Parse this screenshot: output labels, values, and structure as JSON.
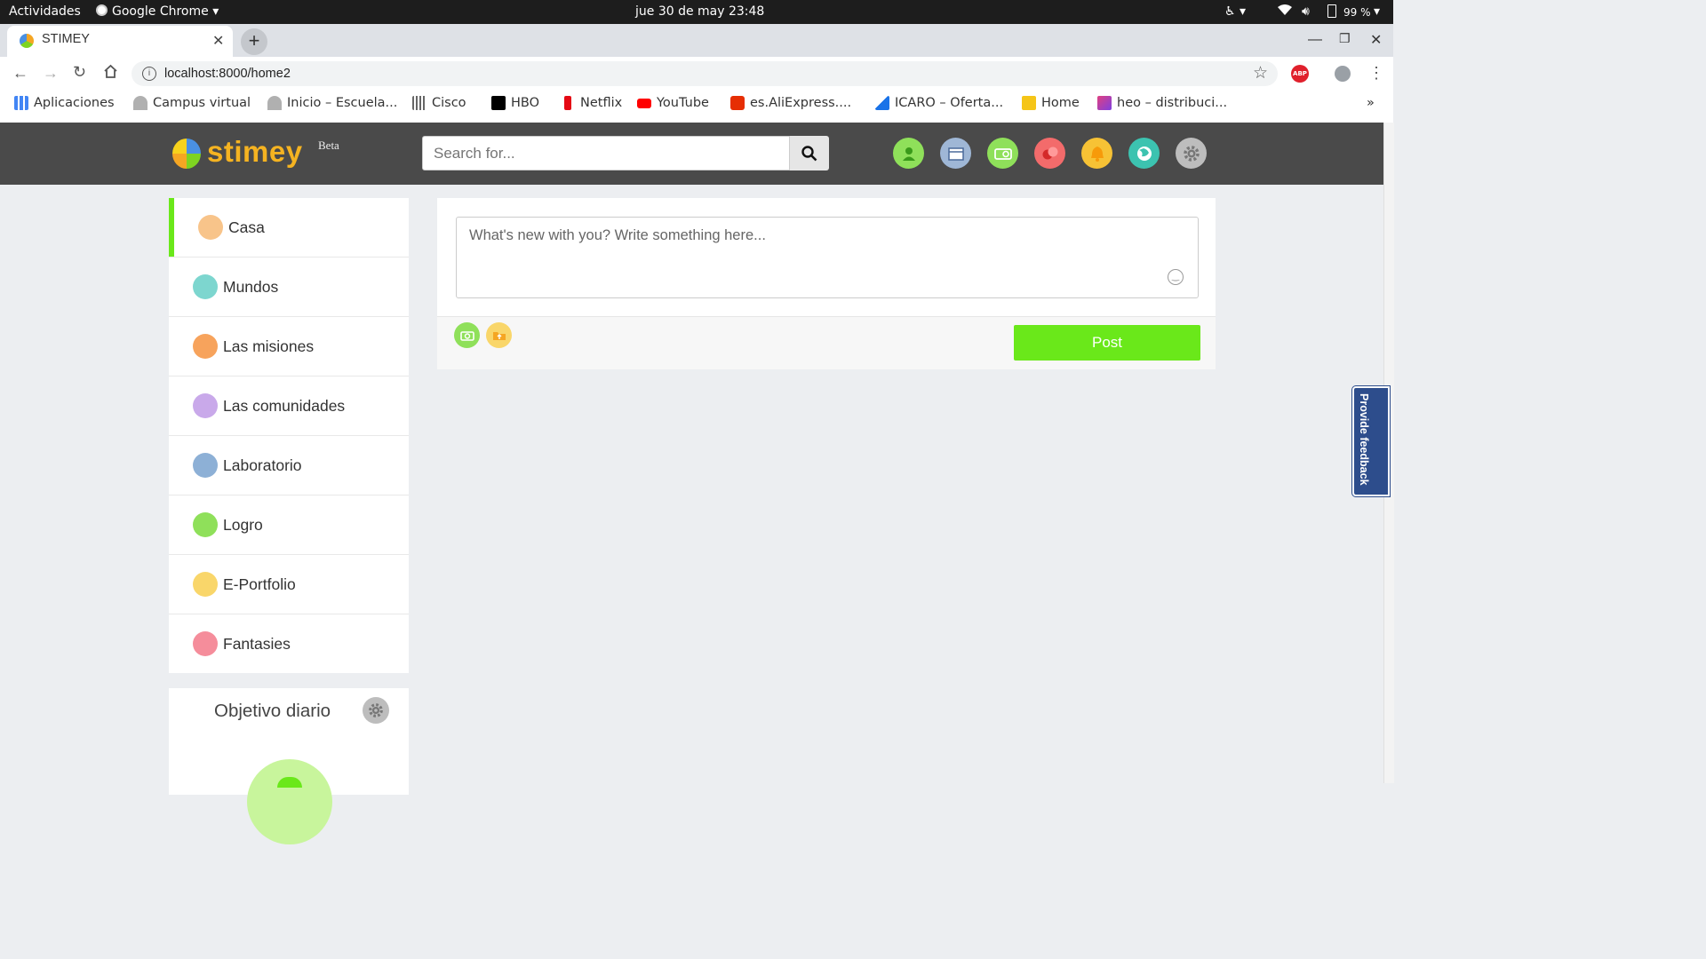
{
  "os_bar": {
    "activities": "Actividades",
    "app_name": "Google Chrome",
    "datetime": "jue 30 de may  23:48",
    "battery": "99 %"
  },
  "browser": {
    "tab_title": "STIMEY",
    "url": "localhost:8000/home2",
    "bookmarks": [
      {
        "label": "Aplicaciones",
        "icon": "apps-grid-icon",
        "color": "#4285f4"
      },
      {
        "label": "Campus virtual",
        "icon": "campus-icon",
        "color": "#9e9e9e"
      },
      {
        "label": "Inicio – Escuela...",
        "icon": "escuela-icon",
        "color": "#9e9e9e"
      },
      {
        "label": "Cisco",
        "icon": "cisco-icon",
        "color": "#555555"
      },
      {
        "label": "HBO",
        "icon": "hbo-icon",
        "color": "#000000"
      },
      {
        "label": "Netflix",
        "icon": "netflix-icon",
        "color": "#e50914"
      },
      {
        "label": "YouTube",
        "icon": "youtube-icon",
        "color": "#ff0000"
      },
      {
        "label": "es.AliExpress....",
        "icon": "aliexpress-icon",
        "color": "#e62e04"
      },
      {
        "label": "ICARO – Oferta...",
        "icon": "icaro-icon",
        "color": "#1a73e8"
      },
      {
        "label": "Home",
        "icon": "home-box-icon",
        "color": "#f5c518"
      },
      {
        "label": "heo – distribuci...",
        "icon": "heo-icon",
        "color": "#e04080"
      }
    ],
    "overflow": "»"
  },
  "site": {
    "logo_text": "stimey",
    "beta": "Beta",
    "search_placeholder": "Search for...",
    "header_icons": [
      {
        "name": "profile-icon",
        "color": "#8fe05a"
      },
      {
        "name": "calendar-icon",
        "color": "#9fb7d6"
      },
      {
        "name": "radio-icon",
        "color": "#8fe05a"
      },
      {
        "name": "chat-icon",
        "color": "#f36b6b"
      },
      {
        "name": "notification-bell-icon",
        "color": "#f7c235"
      },
      {
        "name": "world-icon",
        "color": "#3cc3b0"
      },
      {
        "name": "settings-icon",
        "color": "#bdbdbd"
      }
    ]
  },
  "sidebar": {
    "items": [
      {
        "label": "Casa",
        "color": "#f8c48a"
      },
      {
        "label": "Mundos",
        "color": "#7dd6cf"
      },
      {
        "label": "Las misiones",
        "color": "#f7a35c"
      },
      {
        "label": "Las comunidades",
        "color": "#c9a9ea"
      },
      {
        "label": "Laboratorio",
        "color": "#8db0d6"
      },
      {
        "label": "Logro",
        "color": "#8fe05a"
      },
      {
        "label": "E-Portfolio",
        "color": "#f9d66a"
      },
      {
        "label": "Fantasies",
        "color": "#f58d9b"
      }
    ],
    "active_accent": "#6ae81a"
  },
  "post": {
    "placeholder": "What's new with you? Write something here...",
    "button": "Post"
  },
  "objective": {
    "title": "Objetivo diario"
  },
  "feedback": {
    "label": "Provide feedback"
  }
}
